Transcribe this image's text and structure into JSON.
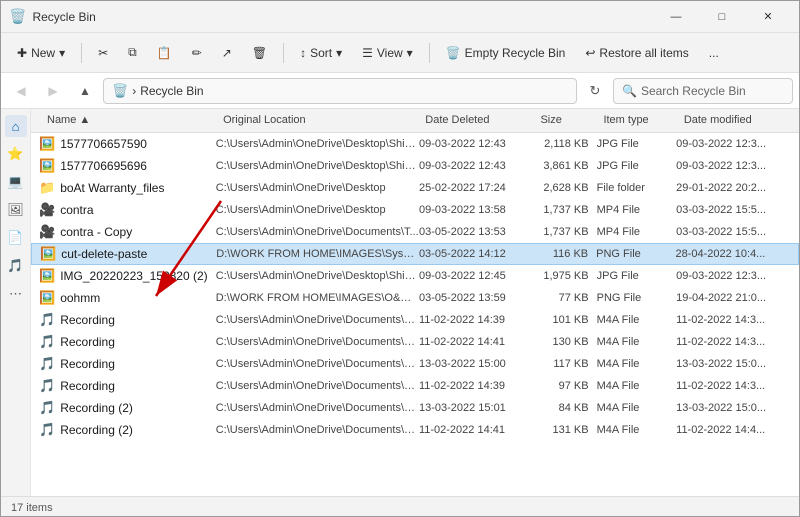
{
  "window": {
    "title": "Recycle Bin",
    "icon": "🗑️"
  },
  "title_controls": {
    "minimize": "—",
    "maximize": "□",
    "close": "✕"
  },
  "toolbar": {
    "new_label": "New",
    "cut_label": "",
    "copy_label": "",
    "paste_label": "",
    "rename_label": "",
    "share_label": "",
    "delete_label": "",
    "sort_label": "Sort",
    "view_label": "View",
    "empty_label": "Empty Recycle Bin",
    "restore_label": "Restore all items",
    "more_label": "..."
  },
  "address_bar": {
    "path": "Recycle Bin",
    "search_placeholder": "Search Recycle Bin"
  },
  "columns": {
    "name": "Name",
    "location": "Original Location",
    "deleted": "Date Deleted",
    "size": "Size",
    "type": "Item type",
    "modified": "Date modified"
  },
  "files": [
    {
      "icon": "🖼️",
      "name": "1577706657590",
      "location": "C:\\Users\\Admin\\OneDrive\\Desktop\\Shiva...",
      "deleted": "09-03-2022 12:43",
      "size": "2,118 KB",
      "type": "JPG File",
      "modified": "09-03-2022 12:3..."
    },
    {
      "icon": "🖼️",
      "name": "1577706695696",
      "location": "C:\\Users\\Admin\\OneDrive\\Desktop\\Shiva...",
      "deleted": "09-03-2022 12:43",
      "size": "3,861 KB",
      "type": "JPG File",
      "modified": "09-03-2022 12:3..."
    },
    {
      "icon": "📁",
      "name": "boAt Warranty_files",
      "location": "C:\\Users\\Admin\\OneDrive\\Desktop",
      "deleted": "25-02-2022 17:24",
      "size": "2,628 KB",
      "type": "File folder",
      "modified": "29-01-2022 20:2..."
    },
    {
      "icon": "🎥",
      "name": "contra",
      "location": "C:\\Users\\Admin\\OneDrive\\Desktop",
      "deleted": "09-03-2022 13:58",
      "size": "1,737 KB",
      "type": "MP4 File",
      "modified": "03-03-2022 15:5..."
    },
    {
      "icon": "🎥",
      "name": "contra - Copy",
      "location": "C:\\Users\\Admin\\OneDrive\\Documents\\T...",
      "deleted": "03-05-2022 13:53",
      "size": "1,737 KB",
      "type": "MP4 File",
      "modified": "03-03-2022 15:5..."
    },
    {
      "icon": "🖼️",
      "name": "cut-delete-paste",
      "location": "D:\\WORK FROM HOME\\IMAGES\\Syswea...",
      "deleted": "03-05-2022 14:12",
      "size": "116 KB",
      "type": "PNG File",
      "modified": "28-04-2022 10:4...",
      "selected": true
    },
    {
      "icon": "🖼️",
      "name": "IMG_20220223_152820 (2)",
      "location": "C:\\Users\\Admin\\OneDrive\\Desktop\\Shiva...",
      "deleted": "09-03-2022 12:45",
      "size": "1,975 KB",
      "type": "JPG File",
      "modified": "09-03-2022 12:3..."
    },
    {
      "icon": "🖼️",
      "name": "oohmm",
      "location": "D:\\WORK FROM HOME\\IMAGES\\O&O Di...",
      "deleted": "03-05-2022 13:59",
      "size": "77 KB",
      "type": "PNG File",
      "modified": "19-04-2022 21:0..."
    },
    {
      "icon": "🎵",
      "name": "Recording",
      "location": "C:\\Users\\Admin\\OneDrive\\Documents\\S...",
      "deleted": "11-02-2022 14:39",
      "size": "101 KB",
      "type": "M4A File",
      "modified": "11-02-2022 14:3..."
    },
    {
      "icon": "🎵",
      "name": "Recording",
      "location": "C:\\Users\\Admin\\OneDrive\\Documents\\S...",
      "deleted": "11-02-2022 14:41",
      "size": "130 KB",
      "type": "M4A File",
      "modified": "11-02-2022 14:3..."
    },
    {
      "icon": "🎵",
      "name": "Recording",
      "location": "C:\\Users\\Admin\\OneDrive\\Documents\\S...",
      "deleted": "13-03-2022 15:00",
      "size": "117 KB",
      "type": "M4A File",
      "modified": "13-03-2022 15:0..."
    },
    {
      "icon": "🎵",
      "name": "Recording",
      "location": "C:\\Users\\Admin\\OneDrive\\Documents\\S...",
      "deleted": "11-02-2022 14:39",
      "size": "97 KB",
      "type": "M4A File",
      "modified": "11-02-2022 14:3..."
    },
    {
      "icon": "🎵",
      "name": "Recording (2)",
      "location": "C:\\Users\\Admin\\OneDrive\\Documents\\S...",
      "deleted": "13-03-2022 15:01",
      "size": "84 KB",
      "type": "M4A File",
      "modified": "13-03-2022 15:0..."
    },
    {
      "icon": "🎵",
      "name": "Recording (2)",
      "location": "C:\\Users\\Admin\\OneDrive\\Documents\\S...",
      "deleted": "11-02-2022 14:41",
      "size": "131 KB",
      "type": "M4A File",
      "modified": "11-02-2022 14:4..."
    }
  ],
  "status_bar": {
    "count": "17 items"
  },
  "sidebar_icons": [
    "▲",
    "⭐",
    "💻",
    "🖼️",
    "📄",
    "🎵",
    "▼"
  ]
}
